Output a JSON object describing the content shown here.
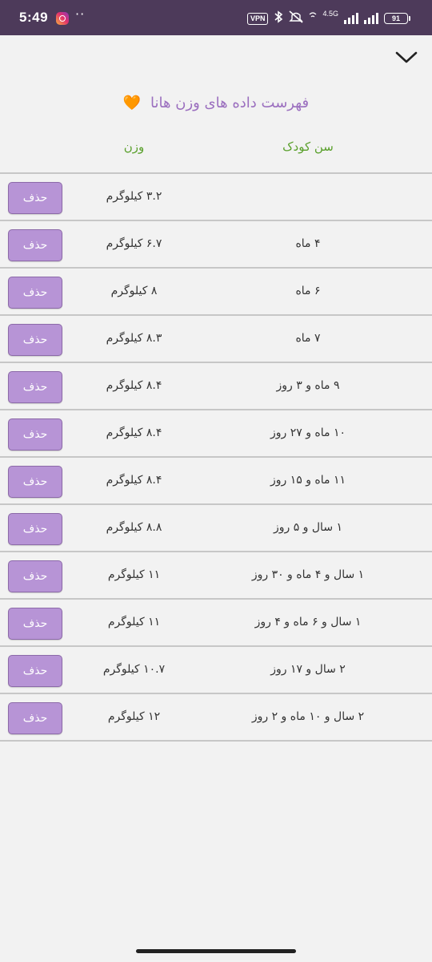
{
  "status_bar": {
    "time": "5:49",
    "dots": "··",
    "vpn": "VPN",
    "network": "4.5G",
    "battery": "91",
    "background": "#4d3a5a"
  },
  "header": {
    "collapse_icon": "chevron-down-icon"
  },
  "page": {
    "title": "فهرست داده های وزن هانا",
    "title_emoji": "🧡",
    "title_color": "#9b6fbf",
    "header_color": "#5aa02c"
  },
  "columns": {
    "age": "سن کودک",
    "weight": "وزن"
  },
  "delete_label": "حذف",
  "button_color": "#b794d6",
  "rows": [
    {
      "age": "",
      "weight": "۳.۲ کیلوگرم"
    },
    {
      "age": "۴ ماه",
      "weight": "۶.۷ کیلوگرم"
    },
    {
      "age": "۶ ماه",
      "weight": "۸ کیلوگرم"
    },
    {
      "age": "۷ ماه",
      "weight": "۸.۳ کیلوگرم"
    },
    {
      "age": "۹ ماه و ۳ روز",
      "weight": "۸.۴ کیلوگرم"
    },
    {
      "age": "۱۰ ماه و ۲۷ روز",
      "weight": "۸.۴ کیلوگرم"
    },
    {
      "age": "۱۱ ماه و ۱۵ روز",
      "weight": "۸.۴ کیلوگرم"
    },
    {
      "age": "۱ سال و ۵ روز",
      "weight": "۸.۸ کیلوگرم"
    },
    {
      "age": "۱ سال و ۴ ماه و ۳۰ روز",
      "weight": "۱۱ کیلوگرم"
    },
    {
      "age": "۱ سال و ۶ ماه و ۴ روز",
      "weight": "۱۱ کیلوگرم"
    },
    {
      "age": "۲ سال و ۱۷ روز",
      "weight": "۱۰.۷ کیلوگرم"
    },
    {
      "age": "۲ سال و ۱۰ ماه و ۲ روز",
      "weight": "۱۲ کیلوگرم"
    }
  ]
}
